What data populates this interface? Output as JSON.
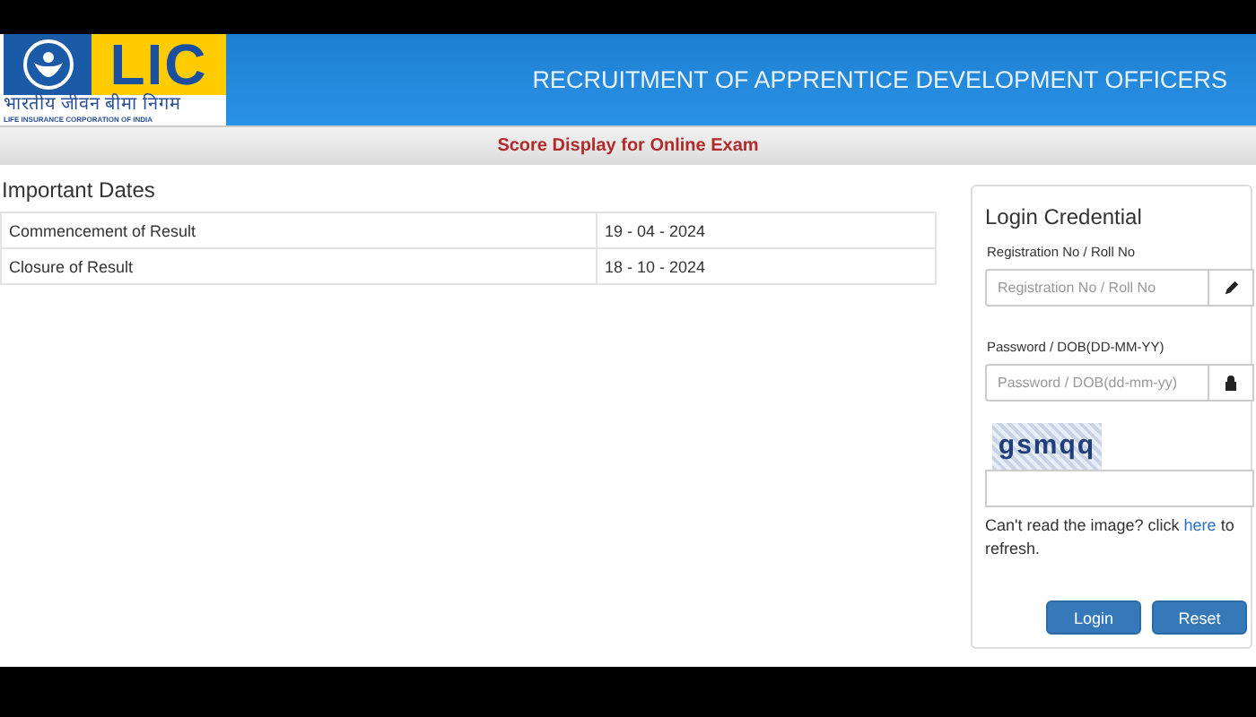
{
  "header": {
    "logo": {
      "mark": "LIC",
      "hindi": "भारतीय जीवन बीमा निगम",
      "english": "LIFE INSURANCE CORPORATION OF INDIA"
    },
    "title": "RECRUITMENT OF APPRENTICE DEVELOPMENT OFFICERS"
  },
  "subheader": "Score Display for Online Exam",
  "important_dates": {
    "title": "Important Dates",
    "rows": [
      {
        "label": "Commencement of Result",
        "date": "19 - 04 - 2024"
      },
      {
        "label": "Closure of Result",
        "date": "18 - 10 - 2024"
      }
    ]
  },
  "login": {
    "title": "Login Credential",
    "fields": [
      {
        "label": "Registration No / Roll No",
        "placeholder": "Registration No / Roll No",
        "kind": "pencil"
      },
      {
        "label": "Password / DOB(DD-MM-YY)",
        "placeholder": "Password / DOB(dd-mm-yy)",
        "kind": "lock"
      }
    ],
    "captcha": "gsmqq",
    "refresh_note": {
      "before": "Can't read the image? click",
      "link": "here",
      "after": "to refresh."
    },
    "buttons": [
      "Login",
      "Reset"
    ]
  }
}
